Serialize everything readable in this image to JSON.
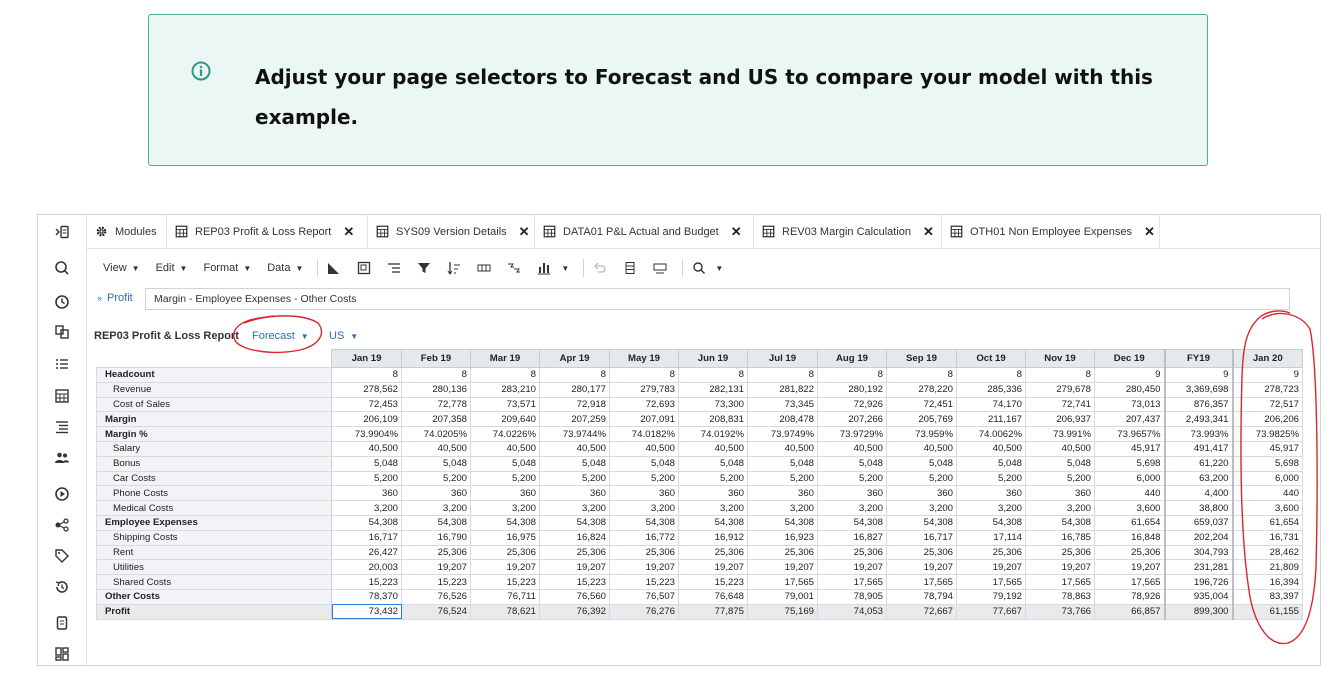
{
  "callout": {
    "message": "Adjust your page selectors to Forecast and US to compare your model with this example.",
    "icon": "info-icon",
    "accent_color": "#4fae94"
  },
  "tabs": [
    {
      "label": "Modules",
      "icon": "gear-icon",
      "closable": false
    },
    {
      "label": "REP03 Profit & Loss Report",
      "icon": "grid-icon",
      "closable": true,
      "active": true
    },
    {
      "label": "SYS09 Version Details",
      "icon": "grid-icon",
      "closable": true
    },
    {
      "label": "DATA01 P&L Actual and Budget",
      "icon": "grid-icon",
      "closable": true
    },
    {
      "label": "REV03 Margin Calculation",
      "icon": "grid-icon",
      "closable": true
    },
    {
      "label": "OTH01 Non Employee Expenses",
      "icon": "grid-icon",
      "closable": true
    }
  ],
  "close_symbol": "✕",
  "toolbar": {
    "menus": [
      "View",
      "Edit",
      "Format",
      "Data"
    ]
  },
  "context": {
    "chip_label": "Profit",
    "breadcrumb": "Margin - Employee Expenses - Other Costs"
  },
  "report": {
    "title": "REP03 Profit & Loss Report",
    "selectors": [
      {
        "label": "Forecast",
        "highlighted": true
      },
      {
        "label": "US",
        "highlighted": false
      }
    ]
  },
  "grid": {
    "columns": [
      "Jan 19",
      "Feb 19",
      "Mar 19",
      "Apr 19",
      "May 19",
      "Jun 19",
      "Jul 19",
      "Aug 19",
      "Sep 19",
      "Oct 19",
      "Nov 19",
      "Dec 19",
      "FY19",
      "Jan 20"
    ],
    "rows": [
      {
        "label": "Headcount",
        "level": "bold",
        "values": [
          "8",
          "8",
          "8",
          "8",
          "8",
          "8",
          "8",
          "8",
          "8",
          "8",
          "8",
          "9",
          "9",
          "9"
        ]
      },
      {
        "label": "Revenue",
        "level": "sub",
        "values": [
          "278,562",
          "280,136",
          "283,210",
          "280,177",
          "279,783",
          "282,131",
          "281,822",
          "280,192",
          "278,220",
          "285,336",
          "279,678",
          "280,450",
          "3,369,698",
          "278,723"
        ]
      },
      {
        "label": "Cost of Sales",
        "level": "sub",
        "values": [
          "72,453",
          "72,778",
          "73,571",
          "72,918",
          "72,693",
          "73,300",
          "73,345",
          "72,926",
          "72,451",
          "74,170",
          "72,741",
          "73,013",
          "876,357",
          "72,517"
        ]
      },
      {
        "label": "Margin",
        "level": "bold",
        "values": [
          "206,109",
          "207,358",
          "209,640",
          "207,259",
          "207,091",
          "208,831",
          "208,478",
          "207,266",
          "205,769",
          "211,167",
          "206,937",
          "207,437",
          "2,493,341",
          "206,206"
        ]
      },
      {
        "label": "Margin %",
        "level": "bold",
        "values": [
          "73.9904%",
          "74.0205%",
          "74.0226%",
          "73.9744%",
          "74.0182%",
          "74.0192%",
          "73.9749%",
          "73.9729%",
          "73.959%",
          "74.0062%",
          "73.991%",
          "73.9657%",
          "73.993%",
          "73.9825%"
        ]
      },
      {
        "label": "Salary",
        "level": "sub",
        "values": [
          "40,500",
          "40,500",
          "40,500",
          "40,500",
          "40,500",
          "40,500",
          "40,500",
          "40,500",
          "40,500",
          "40,500",
          "40,500",
          "45,917",
          "491,417",
          "45,917"
        ]
      },
      {
        "label": "Bonus",
        "level": "sub",
        "values": [
          "5,048",
          "5,048",
          "5,048",
          "5,048",
          "5,048",
          "5,048",
          "5,048",
          "5,048",
          "5,048",
          "5,048",
          "5,048",
          "5,698",
          "61,220",
          "5,698"
        ]
      },
      {
        "label": "Car Costs",
        "level": "sub",
        "values": [
          "5,200",
          "5,200",
          "5,200",
          "5,200",
          "5,200",
          "5,200",
          "5,200",
          "5,200",
          "5,200",
          "5,200",
          "5,200",
          "6,000",
          "63,200",
          "6,000"
        ]
      },
      {
        "label": "Phone Costs",
        "level": "sub",
        "values": [
          "360",
          "360",
          "360",
          "360",
          "360",
          "360",
          "360",
          "360",
          "360",
          "360",
          "360",
          "440",
          "4,400",
          "440"
        ]
      },
      {
        "label": "Medical Costs",
        "level": "sub",
        "values": [
          "3,200",
          "3,200",
          "3,200",
          "3,200",
          "3,200",
          "3,200",
          "3,200",
          "3,200",
          "3,200",
          "3,200",
          "3,200",
          "3,600",
          "38,800",
          "3,600"
        ]
      },
      {
        "label": "Employee Expenses",
        "level": "bold",
        "values": [
          "54,308",
          "54,308",
          "54,308",
          "54,308",
          "54,308",
          "54,308",
          "54,308",
          "54,308",
          "54,308",
          "54,308",
          "54,308",
          "61,654",
          "659,037",
          "61,654"
        ]
      },
      {
        "label": "Shipping Costs",
        "level": "sub",
        "values": [
          "16,717",
          "16,790",
          "16,975",
          "16,824",
          "16,772",
          "16,912",
          "16,923",
          "16,827",
          "16,717",
          "17,114",
          "16,785",
          "16,848",
          "202,204",
          "16,731"
        ]
      },
      {
        "label": "Rent",
        "level": "sub",
        "values": [
          "26,427",
          "25,306",
          "25,306",
          "25,306",
          "25,306",
          "25,306",
          "25,306",
          "25,306",
          "25,306",
          "25,306",
          "25,306",
          "25,306",
          "304,793",
          "28,462"
        ]
      },
      {
        "label": "Utilities",
        "level": "sub",
        "values": [
          "20,003",
          "19,207",
          "19,207",
          "19,207",
          "19,207",
          "19,207",
          "19,207",
          "19,207",
          "19,207",
          "19,207",
          "19,207",
          "19,207",
          "231,281",
          "21,809"
        ]
      },
      {
        "label": "Shared Costs",
        "level": "sub",
        "values": [
          "15,223",
          "15,223",
          "15,223",
          "15,223",
          "15,223",
          "15,223",
          "17,565",
          "17,565",
          "17,565",
          "17,565",
          "17,565",
          "17,565",
          "196,726",
          "16,394"
        ]
      },
      {
        "label": "Other Costs",
        "level": "bold",
        "values": [
          "78,370",
          "76,526",
          "76,711",
          "76,560",
          "76,507",
          "76,648",
          "79,001",
          "78,905",
          "78,794",
          "79,192",
          "78,863",
          "78,926",
          "935,004",
          "83,397"
        ]
      },
      {
        "label": "Profit",
        "level": "bold profit",
        "values": [
          "73,432",
          "76,524",
          "78,621",
          "76,392",
          "76,276",
          "77,875",
          "75,169",
          "74,053",
          "72,667",
          "77,667",
          "73,766",
          "66,857",
          "899,300",
          "61,155"
        ]
      }
    ]
  },
  "colors": {
    "link": "#2d6fb3",
    "annotation": "#d9262e",
    "header_bg": "#e6e9ec"
  }
}
